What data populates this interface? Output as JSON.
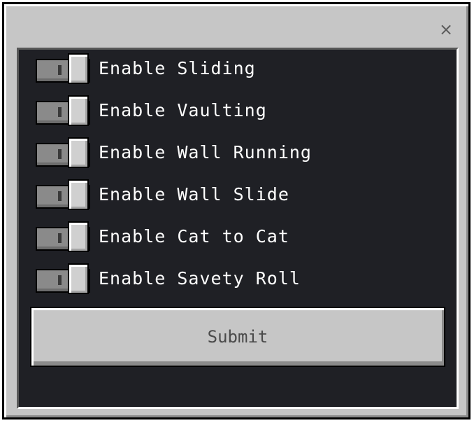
{
  "dialog": {
    "close_glyph": "×"
  },
  "toggles": [
    {
      "label": "Enable Sliding",
      "on": false
    },
    {
      "label": "Enable Vaulting",
      "on": false
    },
    {
      "label": "Enable Wall Running",
      "on": false
    },
    {
      "label": "Enable Wall Slide",
      "on": false
    },
    {
      "label": "Enable Cat to Cat",
      "on": false
    },
    {
      "label": "Enable Savety Roll",
      "on": false
    }
  ],
  "submit": {
    "label": "Submit"
  },
  "colors": {
    "dialog_bg": "#c6c6c6",
    "panel_bg": "#1f2025",
    "label_text": "#ffffff",
    "button_text": "#4a4a4a"
  },
  "icons": {
    "close": "close-icon"
  }
}
